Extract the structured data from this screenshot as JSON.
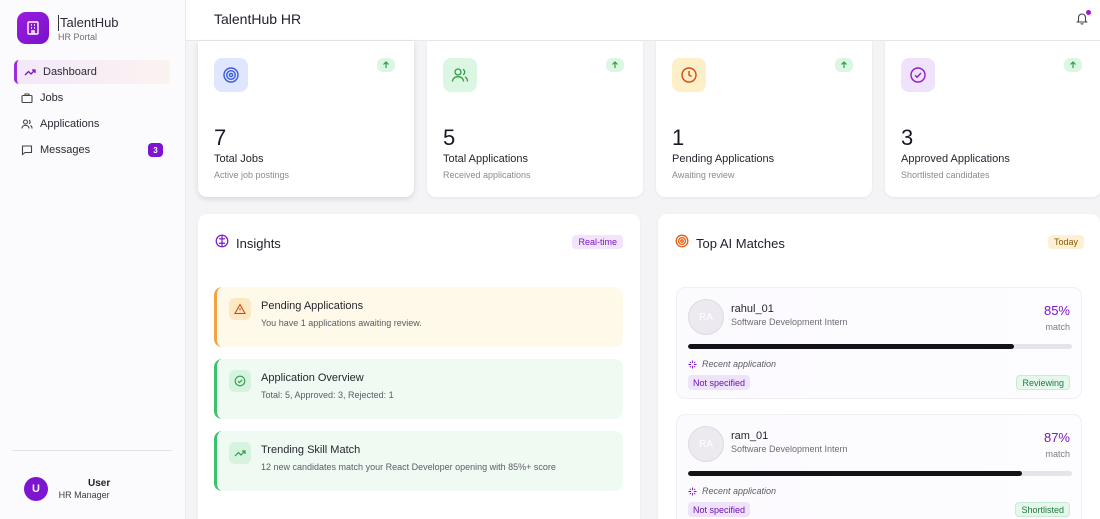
{
  "brand": {
    "title": "TalentHub",
    "subtitle": "HR Portal"
  },
  "nav": [
    {
      "label": "Dashboard",
      "icon": "trend-icon",
      "active": true
    },
    {
      "label": "Jobs",
      "icon": "briefcase-icon"
    },
    {
      "label": "Applications",
      "icon": "users-icon"
    },
    {
      "label": "Messages",
      "icon": "message-icon",
      "badge": "3"
    }
  ],
  "user": {
    "initial": "U",
    "name": "User",
    "role": "HR Manager"
  },
  "header": {
    "title": "TalentHub HR"
  },
  "stats": [
    {
      "value": "7",
      "label": "Total Jobs",
      "sub": "Active job postings",
      "icon": "target-icon",
      "color": "#3b5bdb"
    },
    {
      "value": "5",
      "label": "Total Applications",
      "sub": "Received applications",
      "icon": "users-icon",
      "color": "#2f9e44"
    },
    {
      "value": "1",
      "label": "Pending Applications",
      "sub": "Awaiting review",
      "icon": "clock-icon",
      "color": "#e8590c"
    },
    {
      "value": "3",
      "label": "Approved Applications",
      "sub": "Shortlisted candidates",
      "icon": "check-circle-icon",
      "color": "#8a1fd1"
    }
  ],
  "insights": {
    "title": "Insights",
    "tag": "Real-time",
    "items": [
      {
        "title": "Pending Applications",
        "text": "You have 1 applications awaiting review."
      },
      {
        "title": "Application Overview",
        "text": "Total: 5, Approved: 3, Rejected: 1"
      },
      {
        "title": "Trending Skill Match",
        "text": "12 new candidates match your React Developer opening with 85%+ score"
      }
    ]
  },
  "matches": {
    "title": "Top AI Matches",
    "tag": "Today",
    "items": [
      {
        "initials": "RA",
        "name": "rahul_01",
        "role": "Software Development Intern",
        "pct": "85%",
        "match_label": "match",
        "progress": 0.85,
        "recent": "Recent application",
        "tag": "Not specified",
        "status": "Reviewing"
      },
      {
        "initials": "RA",
        "name": "ram_01",
        "role": "Software Development Intern",
        "pct": "87%",
        "match_label": "match",
        "progress": 0.87,
        "recent": "Recent application",
        "tag": "Not specified",
        "status": "Shortlisted"
      }
    ]
  }
}
